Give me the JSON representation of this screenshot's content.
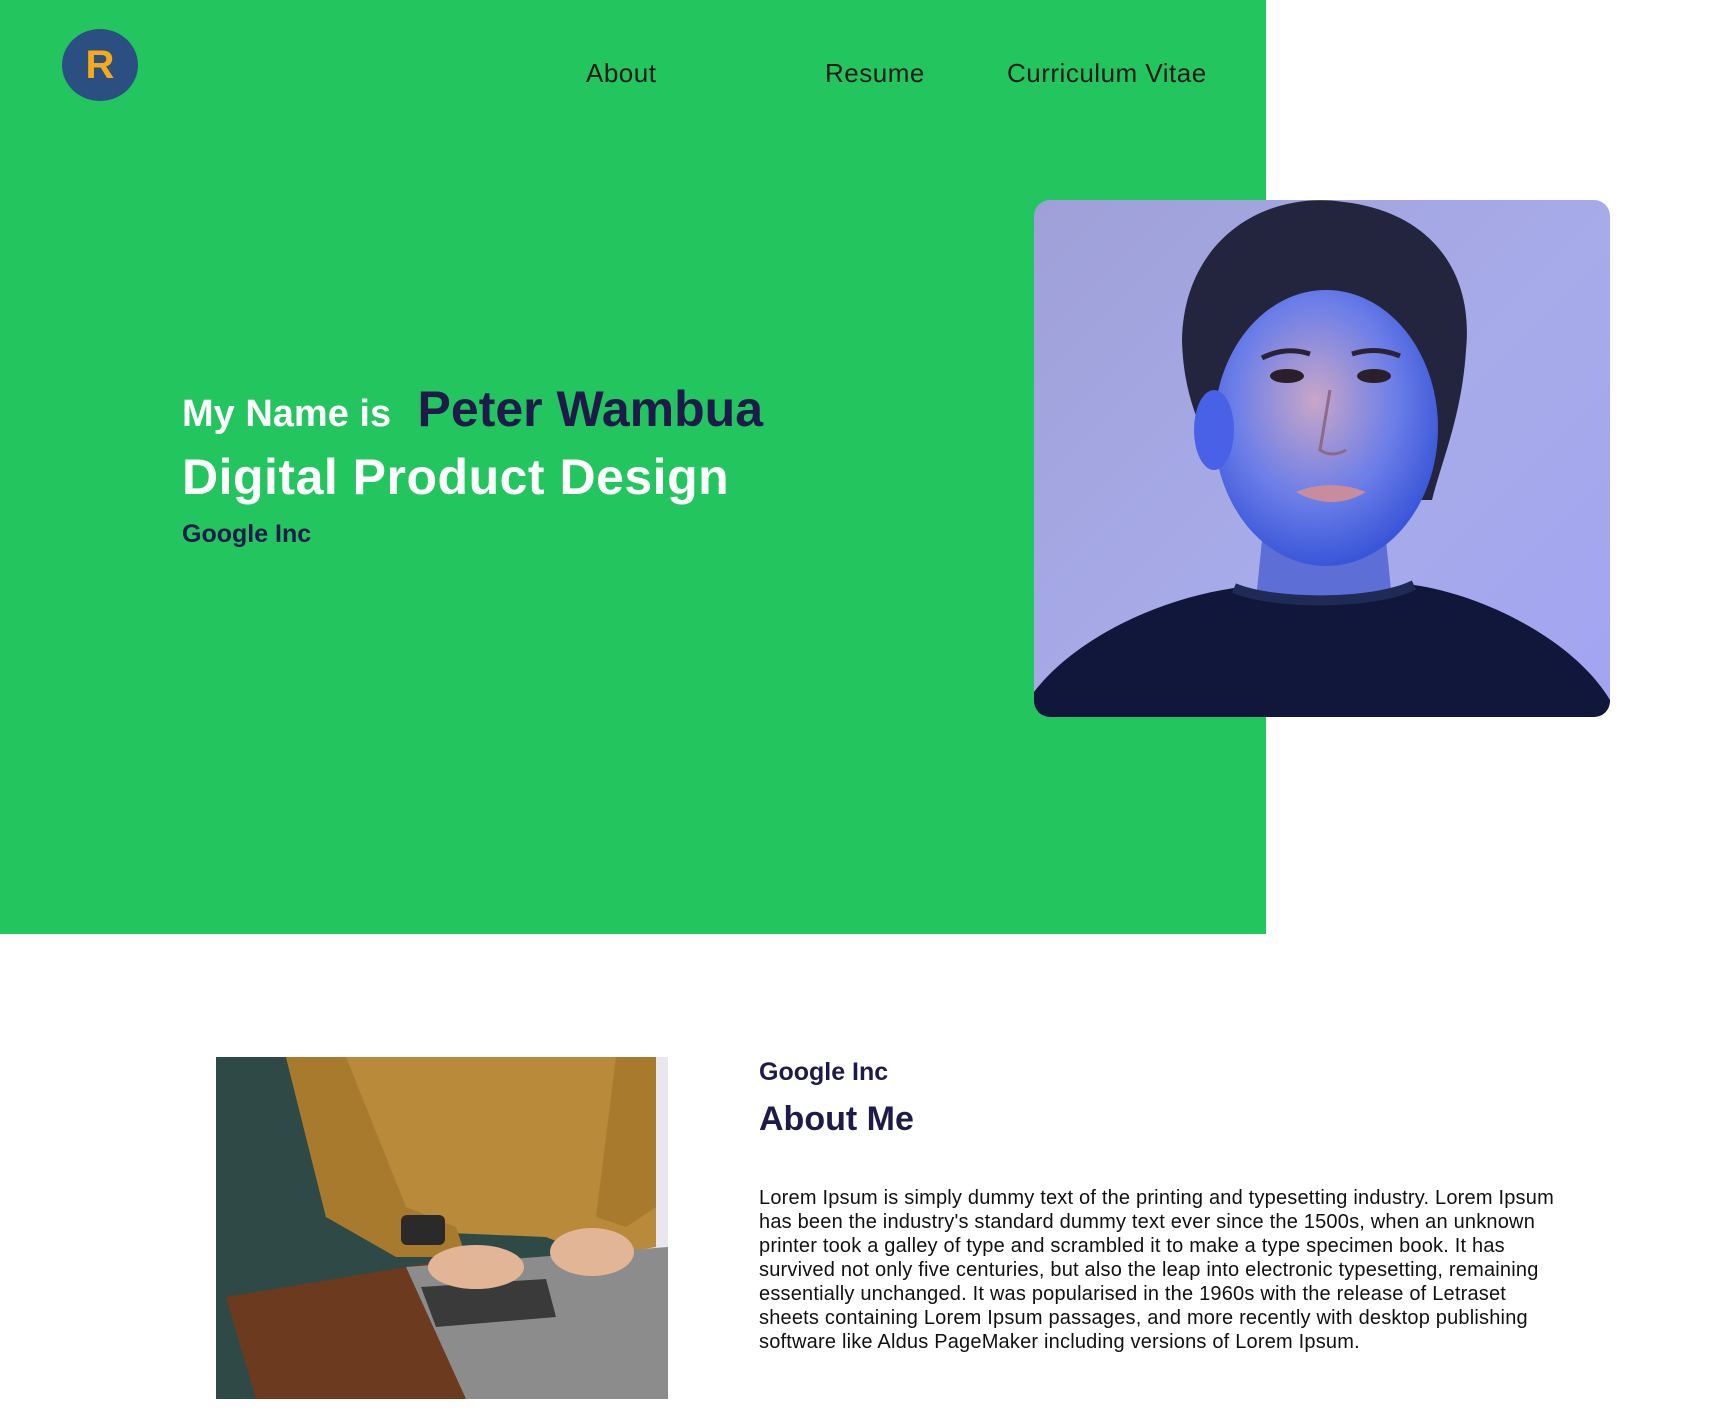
{
  "logo": {
    "letter": "R"
  },
  "nav": {
    "about": "About",
    "resume": "Resume",
    "cv": "Curriculum Vitae"
  },
  "hero": {
    "intro_prefix": "My Name is",
    "name": "Peter Wambua",
    "title": "Digital Product Design",
    "company": "Google Inc"
  },
  "about": {
    "company": "Google Inc",
    "heading": "About Me",
    "body": "Lorem Ipsum is simply dummy text of the printing and typesetting industry. Lorem Ipsum has been the industry's standard dummy text ever since the 1500s, when an unknown printer took a galley of type and scrambled it to make a type specimen book. It has survived not only five centuries, but also the leap into electronic typesetting, remaining essentially unchanged. It was popularised in the 1960s with the release of Letraset sheets containing Lorem Ipsum passages, and more recently with desktop publishing software like Aldus PageMaker including versions of Lorem Ipsum."
  },
  "colors": {
    "hero_background": "#22c55e",
    "logo_background": "#2a4f80",
    "logo_letter": "#f5a91b",
    "accent_text": "#1e1b4b"
  }
}
